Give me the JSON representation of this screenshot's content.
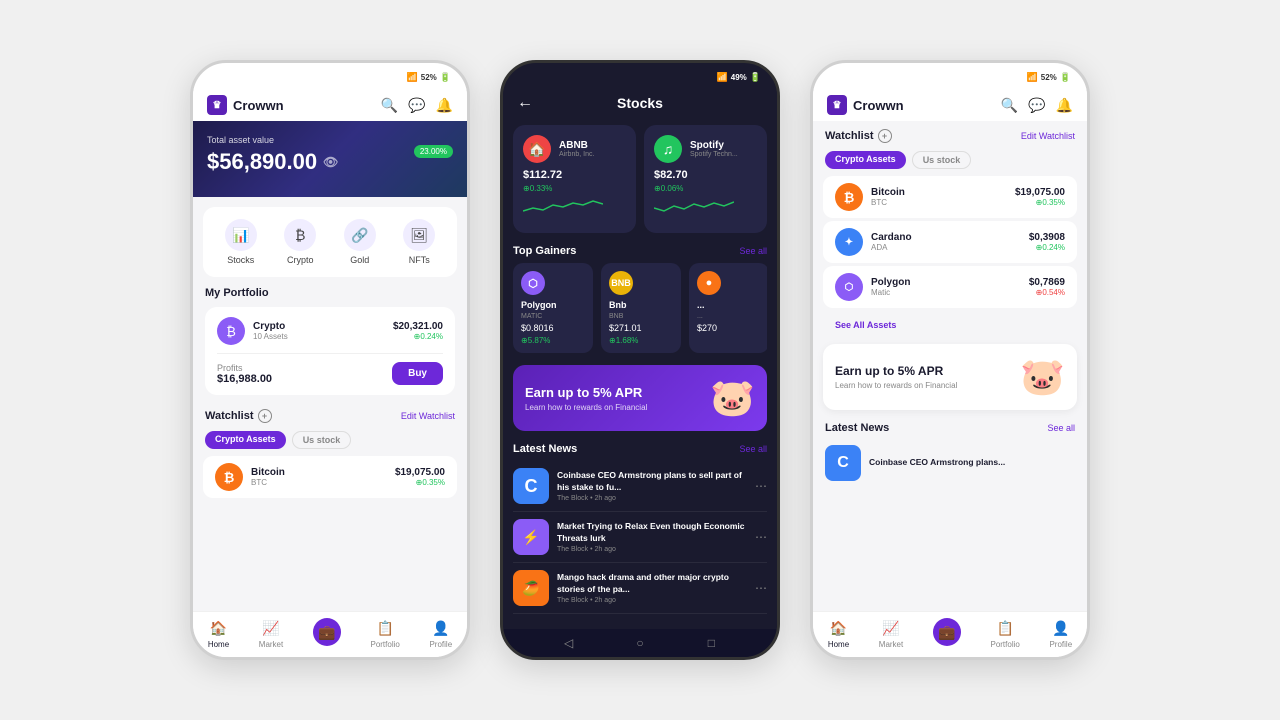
{
  "app": {
    "name": "Crowwn",
    "logo_char": "♛"
  },
  "phone1": {
    "status": {
      "signal": "📶",
      "battery": "52%",
      "time": ""
    },
    "header": {
      "title": "Crowwn",
      "icons": [
        "🔍",
        "💬",
        "🔔"
      ]
    },
    "hero": {
      "label": "Total asset value",
      "amount": "$56,890.00",
      "badge": "23.00%"
    },
    "quick_actions": [
      {
        "icon": "📊",
        "label": "Stocks"
      },
      {
        "icon": "₿",
        "label": "Crypto"
      },
      {
        "icon": "🔗",
        "label": "Gold"
      },
      {
        "icon": "🖼",
        "label": "NFTs"
      }
    ],
    "portfolio": {
      "title": "My Portfolio",
      "item": {
        "icon": "₿",
        "name": "Crypto",
        "sub": "10 Assets",
        "value": "$20,321.00",
        "change": "0.24%"
      },
      "profits_label": "Profits",
      "profits_value": "$16,988.00",
      "buy_label": "Buy"
    },
    "watchlist": {
      "title": "Watchlist",
      "edit_label": "Edit Watchlist",
      "tabs": [
        "Crypto Assets",
        "Us stock"
      ],
      "active_tab": 0,
      "items": [
        {
          "icon": "₿",
          "bg": "bg-orange",
          "name": "Bitcoin",
          "sym": "BTC",
          "value": "$19,075.00",
          "change": "0.35%",
          "up": true
        }
      ]
    },
    "nav": [
      {
        "icon": "🏠",
        "label": "Home",
        "active": true
      },
      {
        "icon": "📈",
        "label": "Market",
        "active": false
      },
      {
        "icon": "💼",
        "label": "Portfolio",
        "active": false,
        "special": true
      },
      {
        "icon": "📋",
        "label": "Portfolio",
        "active": false
      },
      {
        "icon": "👤",
        "label": "Profile",
        "active": false
      }
    ]
  },
  "phone2": {
    "status": {
      "battery": "49%"
    },
    "header": {
      "back": "←",
      "title": "Stocks"
    },
    "stocks": [
      {
        "logo": "🏠",
        "bg": "bg-red",
        "name": "ABNB",
        "sub": "Airbnb, Inc.",
        "price": "$112.72",
        "change": "0.33%",
        "up": true
      },
      {
        "logo": "🎵",
        "bg": "bg-green",
        "name": "Spotify",
        "sub": "Spotify Techn...",
        "price": "$82.70",
        "change": "0.06%",
        "up": true
      }
    ],
    "top_gainers": {
      "title": "Top Gainers",
      "see_all": "See all",
      "items": [
        {
          "icon": "⬡",
          "bg": "bg-purple",
          "name": "Polygon",
          "sym": "MATIC",
          "price": "$0.8016",
          "change": "5.87%",
          "up": true
        },
        {
          "icon": "●",
          "bg": "bg-yellow",
          "name": "Bnb",
          "sym": "BNB",
          "price": "$271.01",
          "change": "1.68%",
          "up": true
        },
        {
          "icon": "●",
          "bg": "bg-orange",
          "name": "...",
          "sym": "...",
          "price": "$270",
          "change": "",
          "up": true
        }
      ]
    },
    "apr_banner": {
      "title": "Earn up to 5% APR",
      "sub": "Learn how to rewards on Financial",
      "emoji": "🐷"
    },
    "news": {
      "title": "Latest News",
      "see_all": "See all",
      "items": [
        {
          "thumb_char": "C",
          "thumb_bg": "bg-blue",
          "headline": "Coinbase CEO Armstrong plans to sell part of his stake to fu...",
          "meta": "The Block • 2h ago"
        },
        {
          "thumb_char": "⚡",
          "thumb_bg": "bg-purple",
          "headline": "Market Trying to Relax Even though Economic Threats lurk",
          "meta": "The Block • 2h ago"
        },
        {
          "thumb_char": "🥭",
          "thumb_bg": "bg-orange",
          "headline": "Mango hack drama and other major crypto stories of the pa...",
          "meta": "The Block • 2h ago"
        }
      ]
    }
  },
  "phone3": {
    "status": {
      "battery": "52%"
    },
    "header": {
      "title": "Crowwn"
    },
    "watchlist": {
      "title": "Watchlist",
      "edit_label": "Edit Watchlist",
      "tabs": [
        "Crypto Assets",
        "Us stock"
      ],
      "active_tab": 0,
      "items": [
        {
          "icon": "₿",
          "bg": "bg-orange",
          "name": "Bitcoin",
          "sym": "BTC",
          "value": "$19,075.00",
          "change": "0.35%",
          "up": true
        },
        {
          "icon": "✦",
          "bg": "bg-blue",
          "name": "Cardano",
          "sym": "ADA",
          "value": "$0,3908",
          "change": "0.24%",
          "up": true
        },
        {
          "icon": "⬡",
          "bg": "bg-purple",
          "name": "Polygon",
          "sym": "Matic",
          "value": "$0,7869",
          "change": "0.54%",
          "up": false
        }
      ]
    },
    "see_all_assets": "See All Assets",
    "apr_card": {
      "title": "Earn up to 5% APR",
      "sub": "Learn how to rewards on Financial",
      "emoji": "🐷"
    },
    "news": {
      "title": "Latest News",
      "see_all": "See all",
      "items": [
        {
          "thumb_char": "C",
          "thumb_bg": "bg-blue",
          "headline": "Coinbase CEO Armstrong plans..."
        }
      ]
    },
    "nav": [
      {
        "icon": "🏠",
        "label": "Home",
        "active": true
      },
      {
        "icon": "📈",
        "label": "Market",
        "active": false
      },
      {
        "icon": "💼",
        "label": "",
        "active": false,
        "special": true
      },
      {
        "icon": "📋",
        "label": "Portfolio",
        "active": false
      },
      {
        "icon": "👤",
        "label": "Profile",
        "active": false
      }
    ]
  }
}
